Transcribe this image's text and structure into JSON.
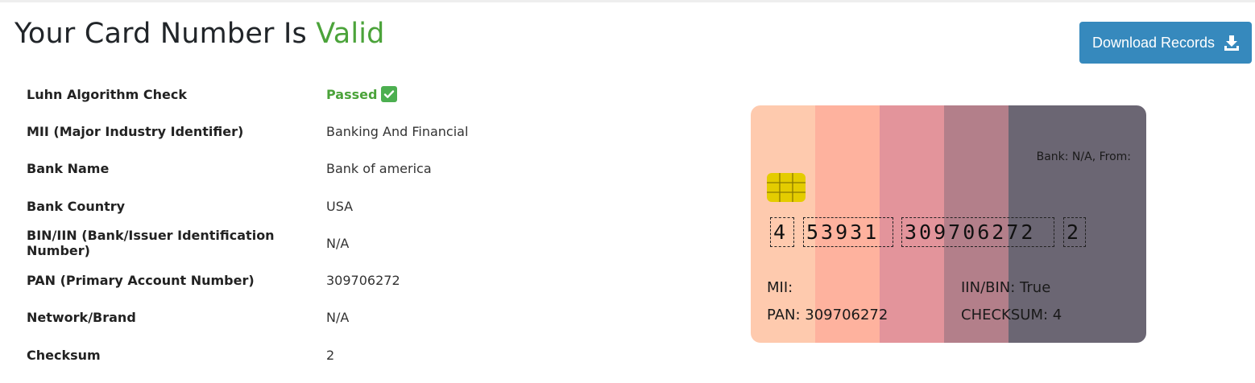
{
  "header": {
    "title_prefix": "Your Card Number Is",
    "title_status": "Valid",
    "download_label": "Download Records"
  },
  "details": [
    {
      "label": "Luhn Algorithm Check",
      "value": "Passed"
    },
    {
      "label": "MII (Major Industry Identifier)",
      "value": "Banking And Financial"
    },
    {
      "label": "Bank Name",
      "value": "Bank of america"
    },
    {
      "label": "Bank Country",
      "value": "USA"
    },
    {
      "label": "BIN/IIN (Bank/Issuer Identification Number)",
      "value": "N/A"
    },
    {
      "label": "PAN (Primary Account Number)",
      "value": "309706272"
    },
    {
      "label": "Network/Brand",
      "value": "N/A"
    },
    {
      "label": "Checksum",
      "value": "2"
    }
  ],
  "card": {
    "bank_info": "Bank: N/A, From:",
    "number_groups": [
      "4",
      "53931",
      "309706272",
      "2"
    ],
    "mii_label": "MII:",
    "iin_label": "IIN/BIN: True",
    "pan_label": "PAN: 309706272",
    "checksum_label": "CHECKSUM: 4",
    "stripe_colors": [
      "#fecaae",
      "#feb29e",
      "#e3949b",
      "#b37f8a",
      "#6b6673"
    ]
  },
  "colors": {
    "valid_accent": "#4ba33a",
    "button_bg": "#3689bd",
    "chip": "#e4cc00"
  },
  "icons": {
    "download": "download-icon",
    "passed": "check-icon"
  }
}
